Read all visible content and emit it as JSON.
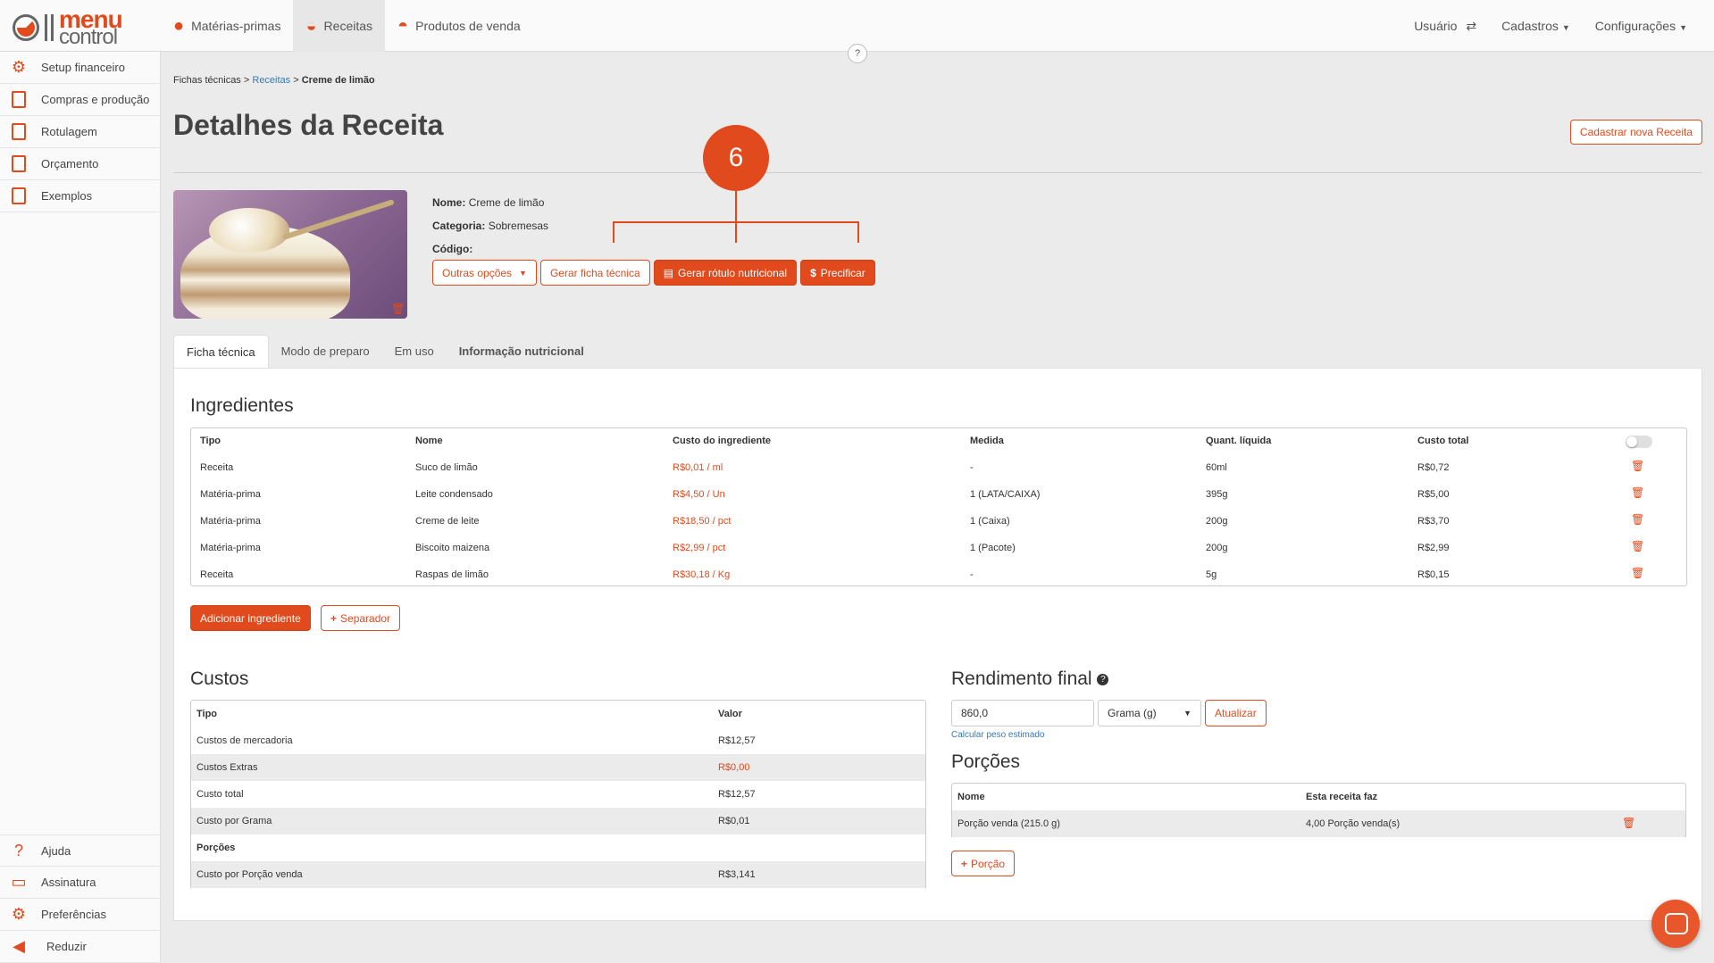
{
  "logo": {
    "line1": "menu",
    "line2": "control"
  },
  "topnav": [
    {
      "label": "Matérias-primas",
      "icon": "tomato-icon"
    },
    {
      "label": "Receitas",
      "icon": "bowl-icon"
    },
    {
      "label": "Produtos de venda",
      "icon": "cloche-icon"
    }
  ],
  "topright": {
    "user": "Usuário",
    "cadastros": "Cadastros",
    "config": "Configurações"
  },
  "help": "?",
  "sidebar": {
    "items": [
      {
        "label": "Setup financeiro"
      },
      {
        "label": "Compras e produção"
      },
      {
        "label": "Rotulagem"
      },
      {
        "label": "Orçamento"
      },
      {
        "label": "Exemplos"
      }
    ],
    "bottom": [
      {
        "label": "Ajuda"
      },
      {
        "label": "Assinatura"
      },
      {
        "label": "Preferências"
      },
      {
        "label": "Reduzir"
      }
    ]
  },
  "breadcrumb": {
    "root": "Fichas técnicas",
    "sep": ">",
    "parent": "Receitas",
    "current": "Creme de limão"
  },
  "title": "Detalhes da Receita",
  "new_button": "Cadastrar nova Receita",
  "recipe": {
    "name_label": "Nome:",
    "name": "Creme de limão",
    "cat_label": "Categoria:",
    "category": "Sobremesas",
    "code_label": "Código:",
    "code": ""
  },
  "annotation": "6",
  "actions": {
    "more": "Outras opções",
    "ficha": "Gerar ficha técnica",
    "rotulo": "Gerar rótulo nutricional",
    "precificar": "Precificar"
  },
  "tabs": [
    {
      "label": "Ficha técnica"
    },
    {
      "label": "Modo de preparo"
    },
    {
      "label": "Em uso"
    },
    {
      "label": "Informação nutricional"
    }
  ],
  "ingredients": {
    "title": "Ingredientes",
    "headers": [
      "Tipo",
      "Nome",
      "Custo do ingrediente",
      "Medida",
      "Quant. líquida",
      "Custo total"
    ],
    "rows": [
      [
        "Receita",
        "Suco de limão",
        "R$0,01 / ml",
        "-",
        "60ml",
        "R$0,72"
      ],
      [
        "Matéria-prima",
        "Leite condensado",
        "R$4,50 / Un",
        "1 (LATA/CAIXA)",
        "395g",
        "R$5,00"
      ],
      [
        "Matéria-prima",
        "Creme de leite",
        "R$18,50 / pct",
        "1 (Caixa)",
        "200g",
        "R$3,70"
      ],
      [
        "Matéria-prima",
        "Biscoito maizena",
        "R$2,99 / pct",
        "1 (Pacote)",
        "200g",
        "R$2,99"
      ],
      [
        "Receita",
        "Raspas de limão",
        "R$30,18 / Kg",
        "-",
        "5g",
        "R$0,15"
      ]
    ],
    "add": "Adicionar ingrediente",
    "separator": "Separador"
  },
  "costs": {
    "title": "Custos",
    "headers": [
      "Tipo",
      "Valor"
    ],
    "rows": [
      [
        "Custos de mercadoria",
        "R$12,57"
      ],
      [
        "Custos Extras",
        "R$0,00"
      ],
      [
        "Custo total",
        "R$12,57"
      ],
      [
        "Custo por Grama",
        "R$0,01"
      ],
      [
        "Porções",
        ""
      ],
      [
        "Custo por Porção venda",
        "R$3,141"
      ]
    ]
  },
  "yield": {
    "title": "Rendimento final",
    "value": "860,0",
    "unit": "Grama (g)",
    "update": "Atualizar",
    "estimate": "Calcular peso estimado"
  },
  "portions": {
    "title": "Porções",
    "headers": [
      "Nome",
      "Esta receita faz"
    ],
    "rows": [
      [
        "Porção venda (215.0 g)",
        "4,00 Porção venda(s)"
      ]
    ],
    "add": "Porção"
  }
}
